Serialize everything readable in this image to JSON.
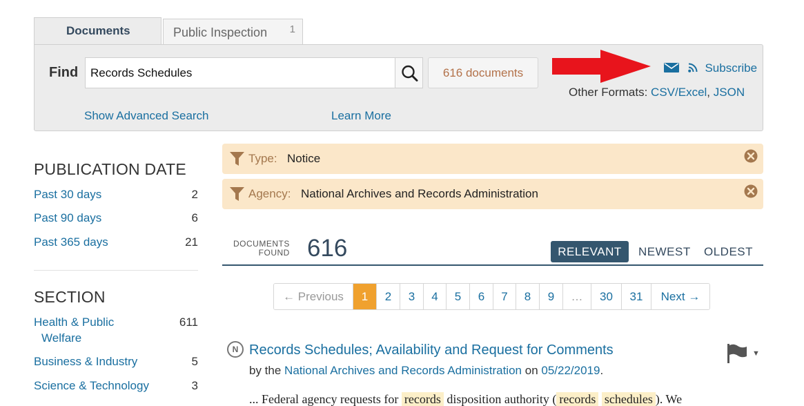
{
  "tabs": {
    "documents": "Documents",
    "public_inspection": "Public Inspection",
    "public_inspection_count": "1"
  },
  "search": {
    "find_label": "Find",
    "query": "Records Schedules",
    "doc_count_label": "616 documents",
    "subscribe": "Subscribe",
    "other_formats_label": "Other Formats:",
    "formats": [
      "CSV/Excel",
      "JSON"
    ],
    "advanced_search": "Show Advanced Search",
    "learn_more": "Learn More"
  },
  "sidebar": {
    "publication_date": {
      "heading": "PUBLICATION DATE",
      "items": [
        {
          "label": "Past 30 days",
          "count": "2"
        },
        {
          "label": "Past 90 days",
          "count": "6"
        },
        {
          "label": "Past 365 days",
          "count": "21"
        }
      ]
    },
    "section": {
      "heading": "SECTION",
      "items": [
        {
          "label_line1": "Health & Public",
          "label_line2": "Welfare",
          "count": "611"
        },
        {
          "label": "Business & Industry",
          "count": "5"
        },
        {
          "label": "Science & Technology",
          "count": "3"
        }
      ]
    }
  },
  "filters": [
    {
      "key": "Type:",
      "value": "Notice"
    },
    {
      "key": "Agency:",
      "value": "National Archives and Records Administration"
    }
  ],
  "results": {
    "found_label_line1": "DOCUMENTS",
    "found_label_line2": "FOUND",
    "count": "616",
    "sort": {
      "relevant": "RELEVANT",
      "newest": "NEWEST",
      "oldest": "OLDEST"
    }
  },
  "pagination": {
    "previous": "← Previous",
    "pages": [
      "1",
      "2",
      "3",
      "4",
      "5",
      "6",
      "7",
      "8",
      "9"
    ],
    "ellipsis": "…",
    "last_pages": [
      "30",
      "31"
    ],
    "next": "Next →",
    "current": "1"
  },
  "result_item": {
    "badge": "N",
    "title": "Records Schedules; Availability and Request for Comments",
    "by": "by the",
    "agency": "National Archives and Records Administration",
    "on": "on",
    "date": "05/22/2019",
    "period": ".",
    "excerpt_1": "... Federal agency requests for",
    "excerpt_hl_1": "records",
    "excerpt_2": "disposition authority (",
    "excerpt_hl_2": "records",
    "excerpt_hl_3": "schedules",
    "excerpt_3": "). We"
  },
  "colors": {
    "link": "#1a6fa0",
    "active_page": "#f0a12e",
    "sort_active": "#34566e",
    "filter_bg": "#fbe7c9",
    "arrow": "#e8141c"
  },
  "icons": [
    "search-icon",
    "envelope-icon",
    "rss-icon",
    "filter-funnel-icon",
    "remove-filter-icon",
    "flag-icon",
    "caret-down-icon",
    "notice-badge-icon",
    "red-arrow-annotation"
  ]
}
